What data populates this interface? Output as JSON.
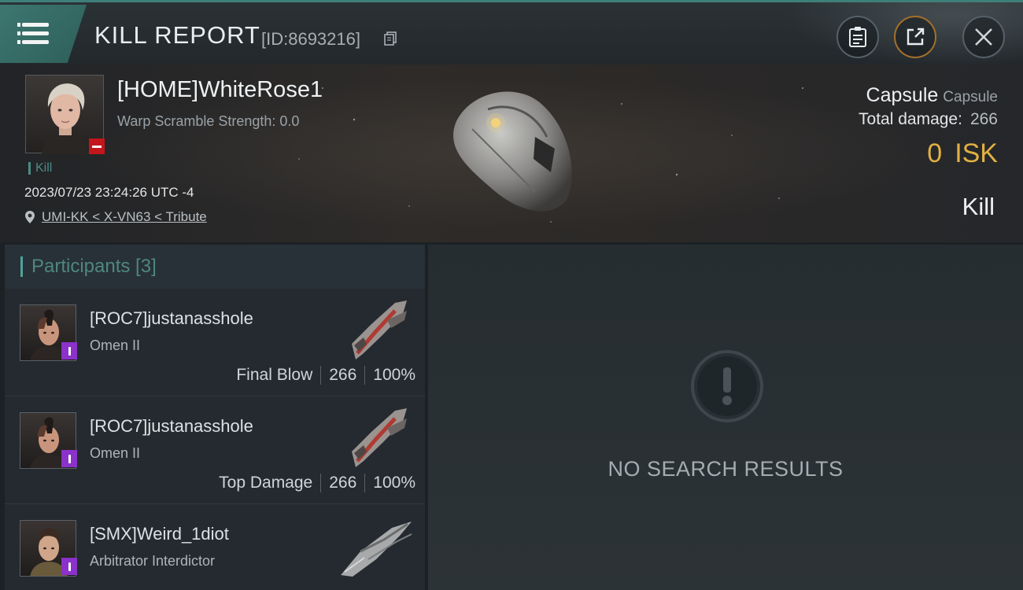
{
  "header": {
    "title": "KILL REPORT",
    "report_id": "[ID:8693216]",
    "menu_icon": "hamburger-icon",
    "buttons": [
      "clipboard-icon",
      "share-icon",
      "close-icon"
    ]
  },
  "victim": {
    "name": "[HOME]WhiteRose1",
    "warp_scramble": "Warp Scramble Strength: 0.0",
    "tag": "Kill",
    "timestamp": "2023/07/23 23:24:26 UTC -4",
    "location": "UMI-KK < X-VN63 < Tribute",
    "ship_name": "Capsule",
    "ship_class": "Capsule",
    "total_damage_label": "Total damage:",
    "total_damage": "266",
    "isk_value": "0",
    "isk_unit": "ISK",
    "result": "Kill"
  },
  "participants": {
    "title": "Participants [3]",
    "rows": [
      {
        "name": "[ROC7]justanasshole",
        "ship": "Omen II",
        "role": "Final Blow",
        "damage": "266",
        "percent": "100%"
      },
      {
        "name": "[ROC7]justanasshole",
        "ship": "Omen II",
        "role": "Top Damage",
        "damage": "266",
        "percent": "100%"
      },
      {
        "name": "[SMX]Weird_1diot",
        "ship": "Arbitrator Interdictor",
        "role": "",
        "damage": "",
        "percent": ""
      }
    ]
  },
  "results": {
    "empty_text": "NO SEARCH RESULTS",
    "icon": "exclamation-icon"
  },
  "colors": {
    "accent_teal": "#3f7f7a",
    "isk_gold": "#e2b043",
    "badge_red": "#c2161b",
    "badge_purple": "#8a32c9"
  }
}
